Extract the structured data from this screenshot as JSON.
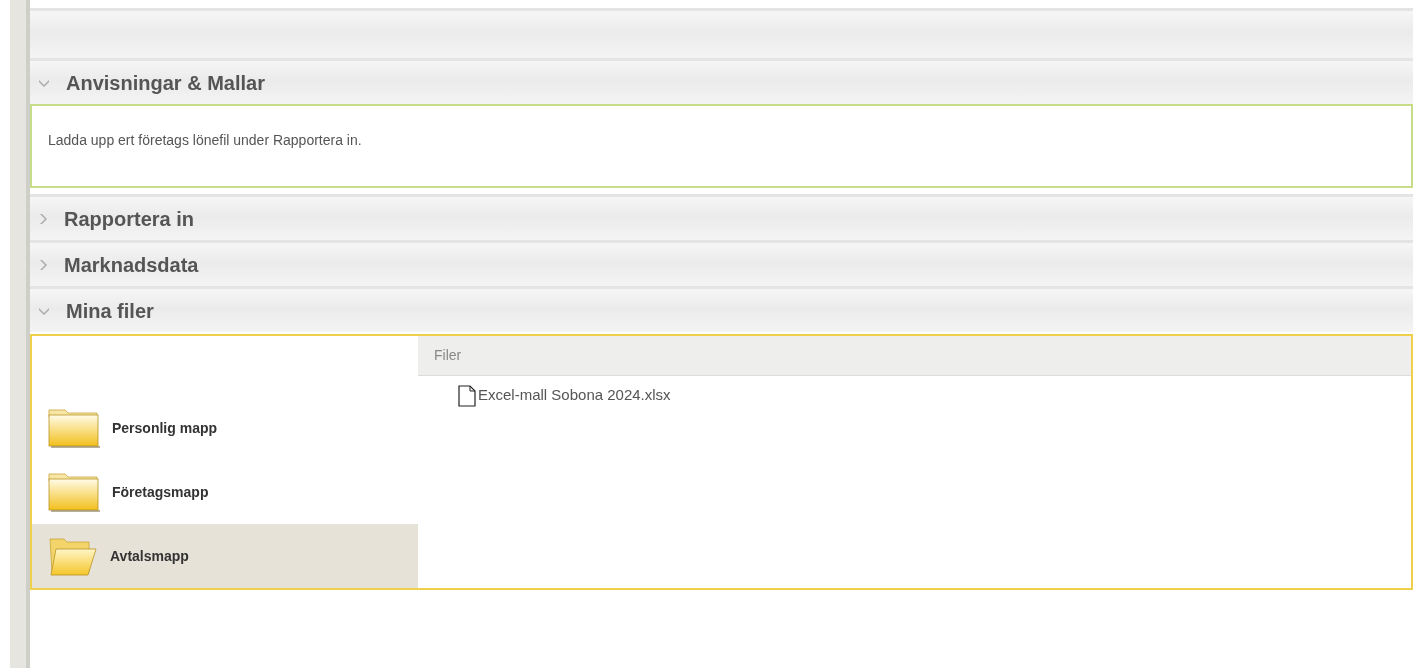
{
  "sections": [
    {
      "title": "Anvisningar & Mallar",
      "expanded": true,
      "body": {
        "kind": "text",
        "text": "Ladda upp ert företags lönefil under Rapportera in."
      }
    },
    {
      "title": "Rapportera in",
      "expanded": false
    },
    {
      "title": "Marknadsdata",
      "expanded": false
    },
    {
      "title": "Mina filer",
      "expanded": true,
      "body": {
        "kind": "files",
        "folders": [
          {
            "name": "Personlig mapp",
            "selected": false
          },
          {
            "name": "Företagsmapp",
            "selected": false
          },
          {
            "name": "Avtalsmapp",
            "selected": true
          }
        ],
        "files_header": "Filer",
        "files": [
          "Excel-mall Sobona 2024.xlsx"
        ]
      }
    }
  ]
}
